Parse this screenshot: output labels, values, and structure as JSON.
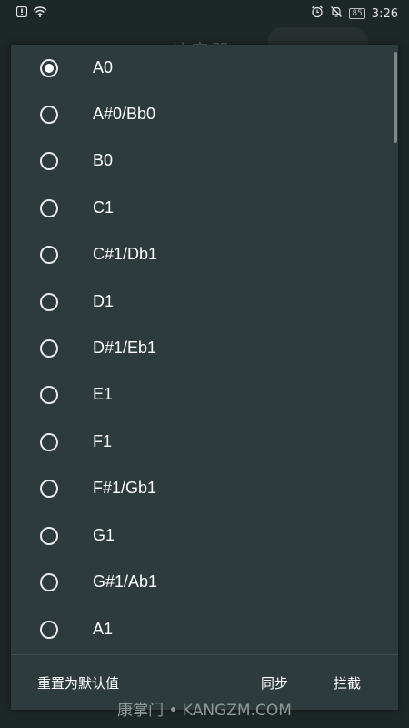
{
  "status_bar": {
    "time": "3:26",
    "battery": "85",
    "icons": [
      "alert-icon",
      "wifi-icon",
      "alarm-icon",
      "bell-off-icon",
      "battery-icon"
    ]
  },
  "background": {
    "title": "校音器"
  },
  "dialog": {
    "options": [
      {
        "label": "A0",
        "selected": true
      },
      {
        "label": "A#0/Bb0",
        "selected": false
      },
      {
        "label": "B0",
        "selected": false
      },
      {
        "label": "C1",
        "selected": false
      },
      {
        "label": "C#1/Db1",
        "selected": false
      },
      {
        "label": "D1",
        "selected": false
      },
      {
        "label": "D#1/Eb1",
        "selected": false
      },
      {
        "label": "E1",
        "selected": false
      },
      {
        "label": "F1",
        "selected": false
      },
      {
        "label": "F#1/Gb1",
        "selected": false
      },
      {
        "label": "G1",
        "selected": false
      },
      {
        "label": "G#1/Ab1",
        "selected": false
      },
      {
        "label": "A1",
        "selected": false
      }
    ],
    "reset_label": "重置为默认值",
    "sync_label": "同步",
    "intercept_label": "拦截"
  },
  "watermark": "康掌门 • KANGZM.COM",
  "colors": {
    "dialog_bg": "#2e3b3c",
    "text": "#ffffff"
  }
}
